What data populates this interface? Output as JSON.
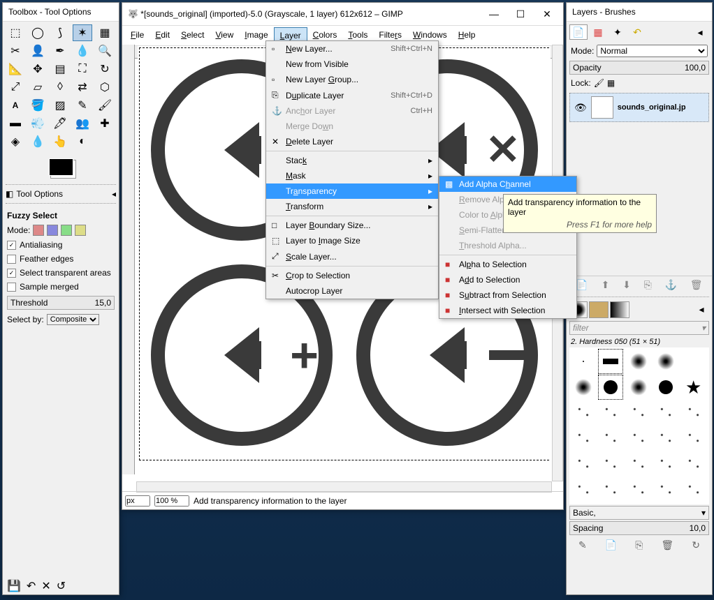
{
  "toolbox": {
    "title": "Toolbox - Tool Options",
    "tool_options_label": "Tool Options",
    "fuzzy_select_label": "Fuzzy Select",
    "mode_label": "Mode:",
    "antialiasing": "Antialiasing",
    "feather_edges": "Feather edges",
    "select_transparent": "Select transparent areas",
    "sample_merged": "Sample merged",
    "threshold_label": "Threshold",
    "threshold_value": "15,0",
    "select_by_label": "Select by:",
    "select_by_value": "Composite"
  },
  "main": {
    "title": "*[sounds_original] (imported)-5.0 (Grayscale, 1 layer) 612x612 – GIMP",
    "menus": [
      "File",
      "Edit",
      "Select",
      "View",
      "Image",
      "Layer",
      "Colors",
      "Tools",
      "Filters",
      "Windows",
      "Help"
    ],
    "px_label": "px",
    "zoom_label": "100 %",
    "status_text": "Add transparency information to the layer"
  },
  "layer_menu": [
    {
      "icon": "▫",
      "label": "New Layer...",
      "shortcut": "Shift+Ctrl+N"
    },
    {
      "icon": "",
      "label": "New from Visible",
      "shortcut": ""
    },
    {
      "icon": "▫",
      "label": "New Layer Group...",
      "shortcut": ""
    },
    {
      "icon": "⎘",
      "label": "Duplicate Layer",
      "shortcut": "Shift+Ctrl+D"
    },
    {
      "icon": "⚓",
      "label": "Anchor Layer",
      "shortcut": "Ctrl+H",
      "disabled": true
    },
    {
      "icon": "",
      "label": "Merge Down",
      "shortcut": "",
      "disabled": true
    },
    {
      "icon": "✕",
      "label": "Delete Layer",
      "shortcut": ""
    },
    {
      "sep": true
    },
    {
      "icon": "",
      "label": "Stack",
      "sub": true
    },
    {
      "icon": "",
      "label": "Mask",
      "sub": true
    },
    {
      "icon": "",
      "label": "Transparency",
      "sub": true,
      "hl": true
    },
    {
      "icon": "",
      "label": "Transform",
      "sub": true
    },
    {
      "sep": true
    },
    {
      "icon": "□",
      "label": "Layer Boundary Size...",
      "shortcut": ""
    },
    {
      "icon": "⬚",
      "label": "Layer to Image Size",
      "shortcut": ""
    },
    {
      "icon": "⤢",
      "label": "Scale Layer...",
      "shortcut": ""
    },
    {
      "sep": true
    },
    {
      "icon": "✂",
      "label": "Crop to Selection",
      "shortcut": ""
    },
    {
      "icon": "",
      "label": "Autocrop Layer",
      "shortcut": ""
    }
  ],
  "trans_menu": [
    {
      "icon": "▩",
      "label": "Add Alpha Channel",
      "hl": true
    },
    {
      "icon": "",
      "label": "Remove Alpha Channel",
      "disabled": true
    },
    {
      "icon": "",
      "label": "Color to Alpha...",
      "disabled": true
    },
    {
      "icon": "",
      "label": "Semi-Flatten",
      "disabled": true
    },
    {
      "icon": "",
      "label": "Threshold Alpha...",
      "disabled": true
    },
    {
      "sep": true
    },
    {
      "icon": "■",
      "label": "Alpha to Selection"
    },
    {
      "icon": "■",
      "label": "Add to Selection"
    },
    {
      "icon": "■",
      "label": "Subtract from Selection"
    },
    {
      "icon": "■",
      "label": "Intersect with Selection"
    }
  ],
  "tooltip": {
    "text": "Add transparency information to the layer",
    "help": "Press F1 for more help"
  },
  "layers": {
    "title": "Layers - Brushes",
    "mode_label": "Mode:",
    "mode_value": "Normal",
    "opacity_label": "Opacity",
    "opacity_value": "100,0",
    "lock_label": "Lock:",
    "layer_name": "sounds_original.jp",
    "filter_placeholder": "filter",
    "brush_info": "2. Hardness 050 (51 × 51)",
    "basic_label": "Basic,",
    "spacing_label": "Spacing",
    "spacing_value": "10,0"
  }
}
